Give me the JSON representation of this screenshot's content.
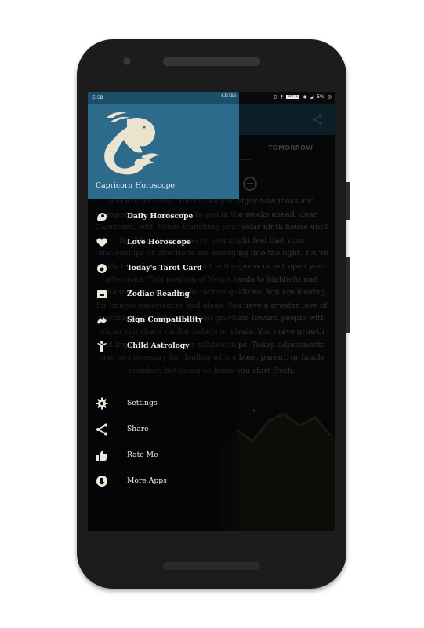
{
  "status_bar": {
    "time": "5:58",
    "net_speed": "4.35 KB/S",
    "lte_badge": "VoLTE",
    "battery": "5%"
  },
  "background_app": {
    "tab_tomorrow": "TOMORROW",
    "horoscope_text": "03-October-2020. You're likely to enjoy new ideas and experiences that come to you in the weeks ahead, dear Capricorn, with Venus transiting your solar ninth house until the 28th. In some ways, you might feel that your relationships or affections are emerging into the light. You're ready to embrace the moment and express or act upon your affections. This position of Venus tends to highlight and enhance your naturally attractive qualities. You are looking for unique experiences and ideas. You have a greater love of learning and sharing, and you gravitate toward people with whom you share similar beliefs or ideals. You crave growth and improvement in your relationships. Today, adjustments may be necessary for dealing with a boss, parent, or family member, but doing so helps you start fresh."
  },
  "drawer": {
    "title": "Capricorn Horoscope",
    "header_color": "#2d6b8d",
    "items": [
      {
        "label": "Daily Horoscope",
        "icon": "horoscope-icon"
      },
      {
        "label": "Love Horoscope",
        "icon": "heart-icon"
      },
      {
        "label": "Today's Tarot Card",
        "icon": "tarot-icon"
      },
      {
        "label": "Zodiac Reading",
        "icon": "reading-icon"
      },
      {
        "label": "Sign Compatibility",
        "icon": "compatibility-icon"
      },
      {
        "label": "Child Astrology",
        "icon": "child-icon"
      }
    ],
    "secondary_items": [
      {
        "label": "Settings",
        "icon": "gear-icon"
      },
      {
        "label": "Share",
        "icon": "share-icon"
      },
      {
        "label": "Rate Me",
        "icon": "thumbs-up-icon"
      },
      {
        "label": "More Apps",
        "icon": "more-apps-icon"
      }
    ]
  }
}
